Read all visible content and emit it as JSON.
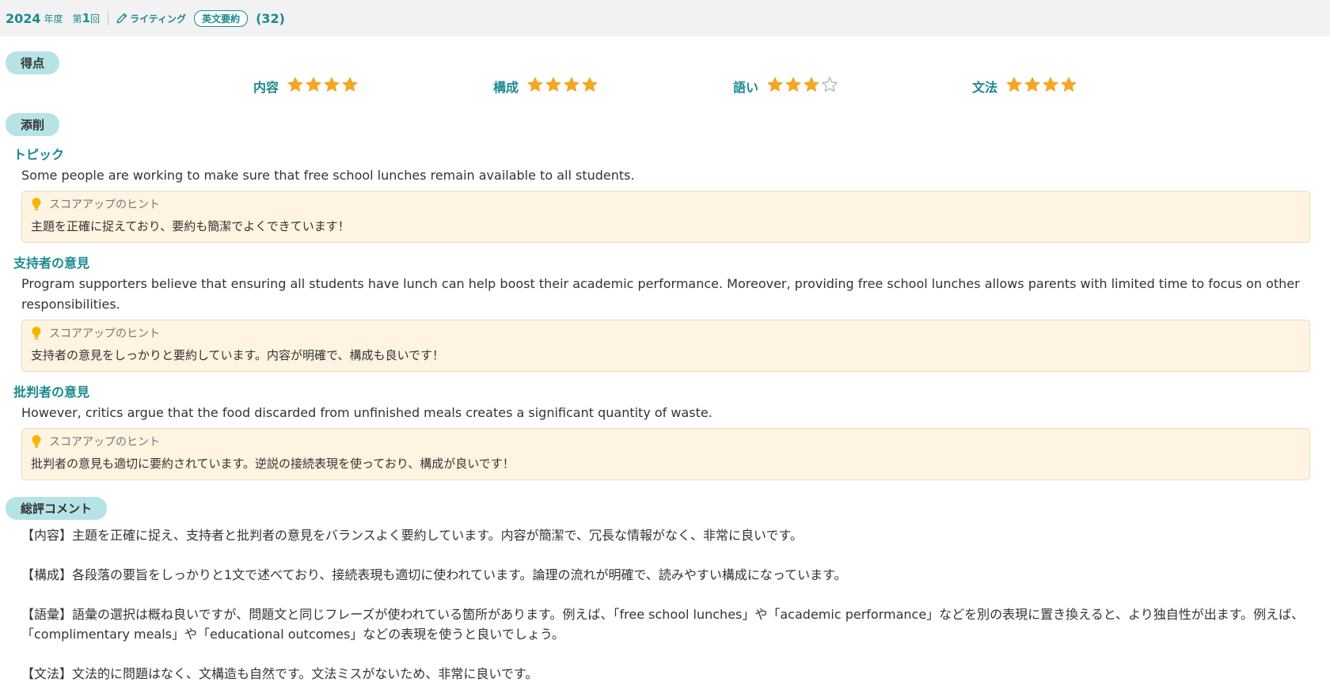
{
  "header": {
    "year": "2024",
    "year_suffix": "年度",
    "round_prefix": "第",
    "round_num": "1",
    "round_suffix": "回",
    "category": "ライティング",
    "tag": "英文要約",
    "count": "(32)"
  },
  "score_section": {
    "label": "得点",
    "items": [
      {
        "label": "内容",
        "stars": 4,
        "max": 4
      },
      {
        "label": "構成",
        "stars": 4,
        "max": 4
      },
      {
        "label": "語い",
        "stars": 3,
        "max": 4
      },
      {
        "label": "文法",
        "stars": 4,
        "max": 4
      }
    ]
  },
  "correction_section": {
    "label": "添削",
    "hint_title": "スコアアップのヒント",
    "items": [
      {
        "title": "トピック",
        "text": "Some people are working to make sure that free school lunches remain available to all students.",
        "hint": "主題を正確に捉えており、要約も簡潔でよくできています！"
      },
      {
        "title": "支持者の意見",
        "text": "Program supporters believe that ensuring all students have lunch can help boost their academic performance. Moreover, providing free school lunches allows parents with limited time to focus on other responsibilities.",
        "hint": "支持者の意見をしっかりと要約しています。内容が明確で、構成も良いです！"
      },
      {
        "title": "批判者の意見",
        "text": "However, critics argue that the food discarded from unfinished meals creates a significant quantity of waste.",
        "hint": "批判者の意見も適切に要約されています。逆説の接続表現を使っており、構成が良いです！"
      }
    ]
  },
  "overall_section": {
    "label": "総評コメント",
    "comments": [
      "【内容】主題を正確に捉え、支持者と批判者の意見をバランスよく要約しています。内容が簡潔で、冗長な情報がなく、非常に良いです。",
      "【構成】各段落の要旨をしっかりと1文で述べており、接続表現も適切に使われています。論理の流れが明確で、読みやすい構成になっています。",
      "【語彙】語彙の選択は概ね良いですが、問題文と同じフレーズが使われている箇所があります。例えば、「free school lunches」や「academic performance」などを別の表現に置き換えると、より独自性が出ます。例えば、「complimentary meals」や「educational outcomes」などの表現を使うと良いでしょう。",
      "【文法】文法的に問題はなく、文構造も自然です。文法ミスがないため、非常に良いです。"
    ]
  },
  "colors": {
    "accent": "#1a8a8f",
    "pill_bg": "#b6e3e6",
    "star_filled": "#f5a623",
    "star_empty": "#bbbbbb",
    "hint_bg": "#fff3e1",
    "bulb": "#f5b400"
  },
  "icons": {
    "category_icon": "pencil-icon",
    "hint_icon": "lightbulb-icon",
    "score_icon": "star-icon"
  }
}
